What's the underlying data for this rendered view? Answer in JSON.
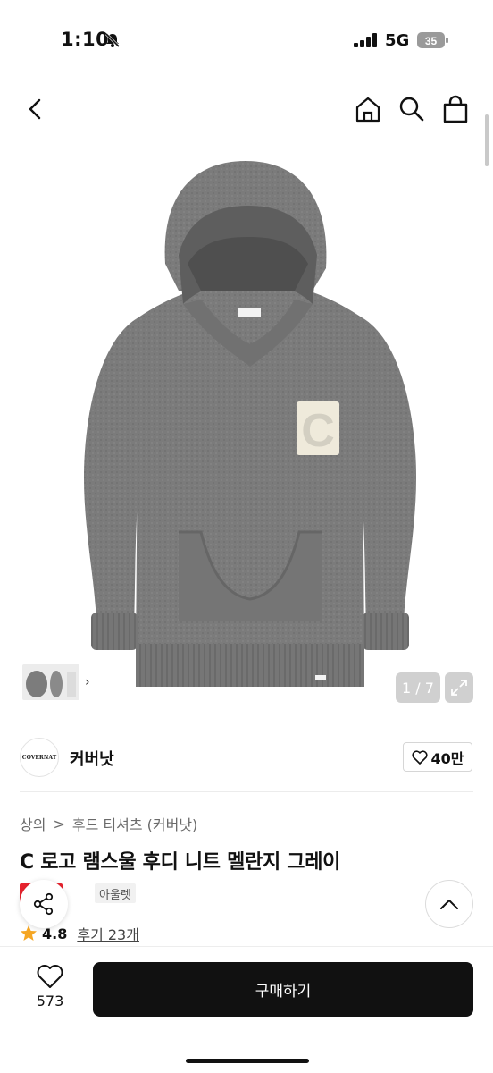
{
  "status": {
    "time": "1:10",
    "network": "5G",
    "battery": "35"
  },
  "icons": {
    "back": "chevron-left-icon",
    "home": "home-icon",
    "search": "search-icon",
    "cart": "shopping-bag-icon",
    "expand": "expand-icon",
    "follow": "heart-icon",
    "share": "share-icon",
    "top": "chevron-up-icon",
    "star": "star-icon",
    "like": "heart-icon"
  },
  "gallery": {
    "counter": "1 / 7",
    "current": 1,
    "total": 7
  },
  "brand": {
    "logo_text": "COVERNAT",
    "name": "커버낫",
    "follow_count": "40만"
  },
  "breadcrumb": {
    "level1": "상의",
    "separator": ">",
    "level2": "후드 티셔츠 (커버낫)"
  },
  "product": {
    "title": "C 로고 램스울 후디 니트 멜란지 그레이",
    "badge_sale": "세일",
    "badge_outlet": "아울렛",
    "rating": "4.8",
    "reviews": "후기 23개"
  },
  "bottom": {
    "like_count": "573",
    "buy_label": "구매하기"
  },
  "colors": {
    "accent": "#111111",
    "sale": "#e8232e",
    "star": "#f5a623",
    "sweater": "#7a7a7a",
    "patch": "#efeadb"
  }
}
